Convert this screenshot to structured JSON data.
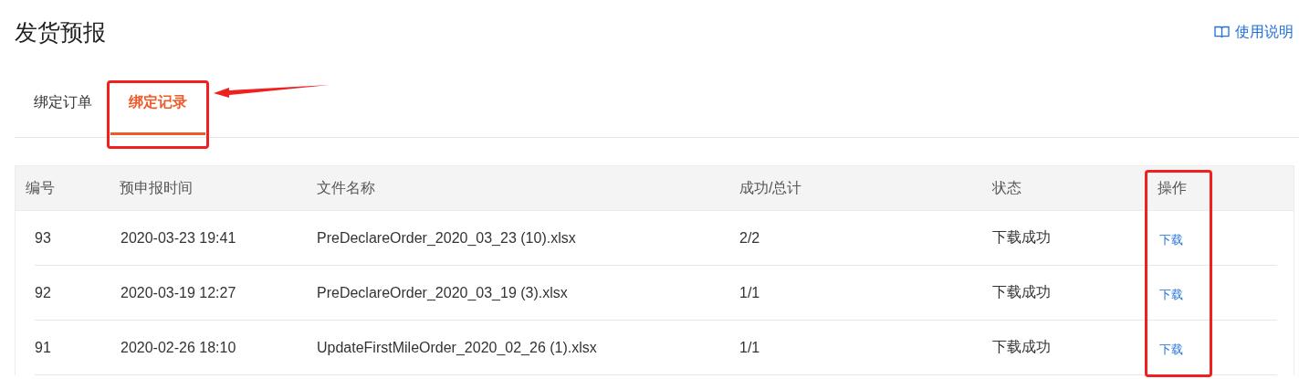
{
  "page": {
    "title": "发货预报",
    "help_link": "使用说明"
  },
  "tabs": [
    {
      "label": "绑定订单",
      "selected": false
    },
    {
      "label": "绑定记录",
      "selected": true,
      "highlighted": true,
      "arrow": true
    }
  ],
  "table": {
    "columns": [
      {
        "label": "编号"
      },
      {
        "label": "预申报时间"
      },
      {
        "label": "文件名称"
      },
      {
        "label": "成功/总计"
      },
      {
        "label": "状态"
      },
      {
        "label": "操作",
        "highlighted": true
      }
    ],
    "rows": [
      [
        "93",
        "2020-03-23 19:41",
        "PreDeclareOrder_2020_03_23 (10).xlsx",
        "2/2",
        "下载成功",
        "下载"
      ],
      [
        "92",
        "2020-03-19 12:27",
        "PreDeclareOrder_2020_03_19 (3).xlsx",
        "1/1",
        "下载成功",
        "下载"
      ],
      [
        "91",
        "2020-02-26 18:10",
        "UpdateFirstMileOrder_2020_02_26 (1).xlsx",
        "1/1",
        "下载成功",
        "下载"
      ]
    ]
  }
}
